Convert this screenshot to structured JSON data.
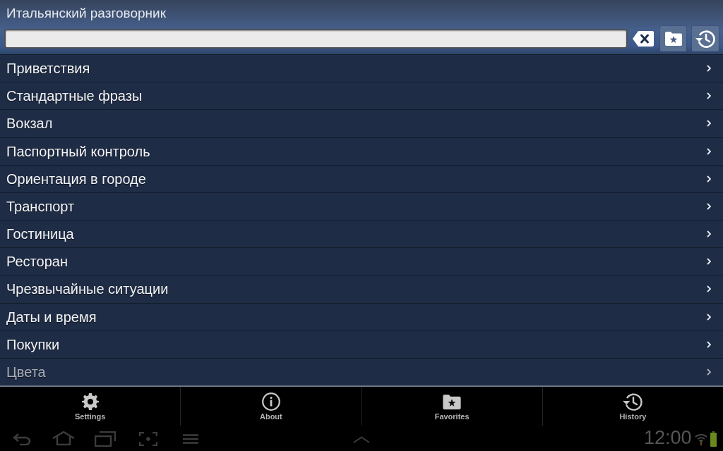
{
  "app_bar": {
    "title": "Итальянский разговорник"
  },
  "categories": [
    {
      "label": "Приветствия"
    },
    {
      "label": "Стандартные фразы"
    },
    {
      "label": "Вокзал"
    },
    {
      "label": "Паспортный контроль"
    },
    {
      "label": "Ориентация в городе"
    },
    {
      "label": "Транспорт"
    },
    {
      "label": "Гостиница"
    },
    {
      "label": "Ресторан"
    },
    {
      "label": "Чрезвычайные ситуации"
    },
    {
      "label": "Даты и время"
    },
    {
      "label": "Покупки"
    },
    {
      "label": "Цвета"
    }
  ],
  "bottom_tabs": [
    {
      "label": "Settings"
    },
    {
      "label": "About"
    },
    {
      "label": "Favorites"
    },
    {
      "label": "History"
    }
  ],
  "system_bar": {
    "time": "12:00"
  }
}
